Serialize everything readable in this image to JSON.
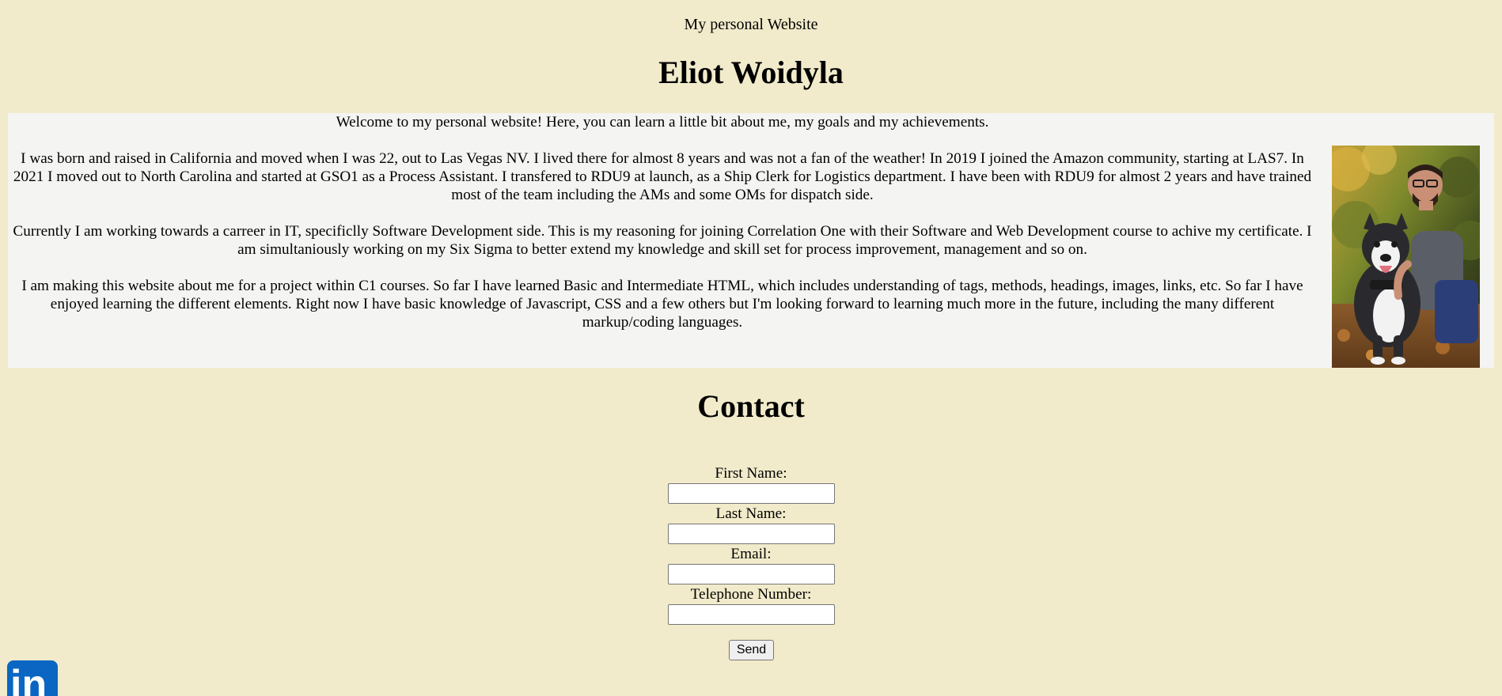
{
  "header": {
    "site_label": "My personal Website",
    "title": "Eliot Woidyla"
  },
  "about": {
    "paragraphs": [
      "Welcome to my personal website! Here, you can learn a little bit about me, my goals and my achievements.",
      "I was born and raised in California and moved when I was 22, out to Las Vegas NV. I lived there for almost 8 years and was not a fan of the weather! In 2019 I joined the Amazon community, starting at LAS7. In 2021 I moved out to North Carolina and started at GSO1 as a Process Assistant. I transfered to RDU9 at launch, as a Ship Clerk for Logistics department. I have been with RDU9 for almost 2 years and have trained most of the team including the AMs and some OMs for dispatch side.",
      "Currently I am working towards a carreer in IT, specificlly Software Development side. This is my reasoning for joining Correlation One with their Software and Web Development course to achive my certificate. I am simultaniously working on my Six Sigma to better extend my knowledge and skill set for process improvement, management and so on.",
      "I am making this website about me for a project within C1 courses. So far I have learned Basic and Intermediate HTML, which includes understanding of tags, methods, headings, images, links, etc. So far I have enjoyed learning the different elements. Right now I have basic knowledge of Javascript, CSS and a few others but I'm looking forward to learning much more in the future, including the many different markup/coding languages."
    ]
  },
  "contact": {
    "title": "Contact",
    "first_name_label": "First Name:",
    "first_name_value": "",
    "last_name_label": "Last Name:",
    "last_name_value": "",
    "email_label": "Email:",
    "email_value": "",
    "phone_label": "Telephone Number:",
    "phone_value": "",
    "send_label": "Send"
  },
  "footer": {
    "linkedin_icon": "linkedin-icon",
    "linkedin_text": "in",
    "linkedin_color": "#0a66c2"
  },
  "colors": {
    "page_background": "#f1ebcb",
    "about_background": "#f4f4f3"
  }
}
